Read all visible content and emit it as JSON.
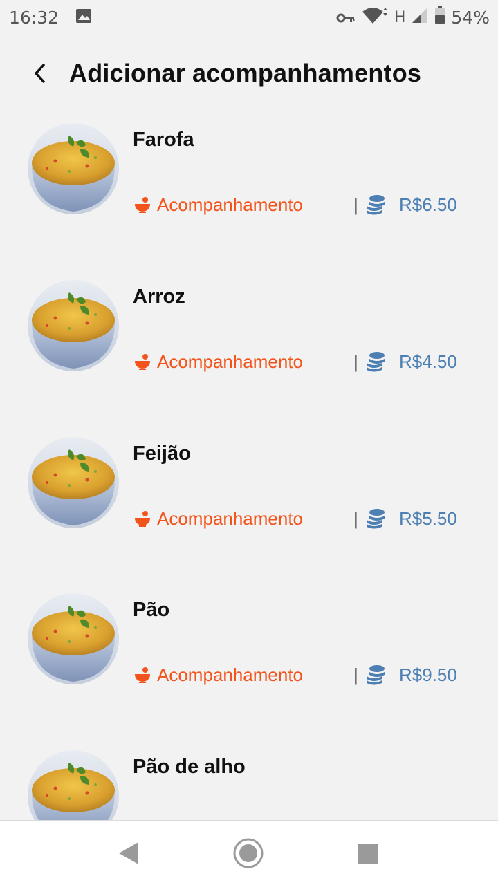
{
  "status_bar": {
    "time": "16:32",
    "network": "H",
    "battery": "54%"
  },
  "header": {
    "title": "Adicionar acompanhamentos"
  },
  "items": [
    {
      "name": "Farofa",
      "category": "Acompanhamento",
      "separator": "|",
      "price": "R$6.50"
    },
    {
      "name": "Arroz",
      "category": "Acompanhamento",
      "separator": "|",
      "price": "R$4.50"
    },
    {
      "name": "Feijão",
      "category": "Acompanhamento",
      "separator": "|",
      "price": "R$5.50"
    },
    {
      "name": "Pão",
      "category": "Acompanhamento",
      "separator": "|",
      "price": "R$9.50"
    },
    {
      "name": "Pão de alho"
    }
  ],
  "colors": {
    "category": "#f2541b",
    "price": "#4d7fb3",
    "background": "#f2f2f2"
  },
  "icons": {
    "back": "chevron-left-icon",
    "category": "bowl-icon",
    "price": "coins-icon"
  }
}
